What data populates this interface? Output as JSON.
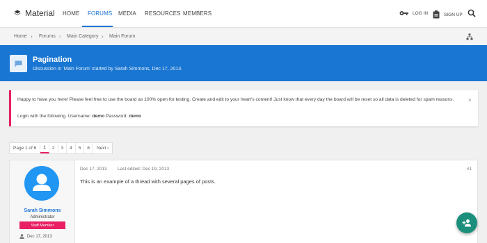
{
  "header": {
    "logo_text": "Material",
    "nav": [
      "HOME",
      "FORUMS",
      "MEDIA",
      "RESOURCES",
      "MEMBERS"
    ],
    "active_nav": "FORUMS",
    "login_label": "LOG IN",
    "signup_label": "SIGN UP"
  },
  "breadcrumb": [
    "Home",
    "Forums",
    "Main Category",
    "Main Forum"
  ],
  "thread": {
    "title": "Pagination",
    "meta": "Discussion in 'Main Forum' started by Sarah Simmons, Dec 17, 2013."
  },
  "notice": {
    "line1": "Happy to have you here! Please feel free to use the board as 100% open for testing. Create and edit to your heart's content! Just know that every day the board will be reset so all data is deleted for spam reasons.",
    "line2_prefix": "Login with the following. Username:",
    "username": "demo",
    "password_label": "Password:",
    "password": "demo",
    "close_icon": "×"
  },
  "pagination": {
    "label": "Page 1 of 6",
    "pages": [
      "1",
      "2",
      "3",
      "4",
      "5",
      "6"
    ],
    "current": "1",
    "next_label": "Next ›"
  },
  "post": {
    "author": "Sarah Simmons",
    "author_title": "Administrator",
    "badge": "Staff Member",
    "join_date": "Dec 17, 2013",
    "date": "Dec 17, 2013",
    "edited": "Last edited: Dec 19, 2013",
    "number": "#1",
    "body": "This is an example of a thread with several pages of posts."
  },
  "colors": {
    "accent": "#1976d2",
    "pink": "#e91e63",
    "fab": "#1b8e7c"
  }
}
